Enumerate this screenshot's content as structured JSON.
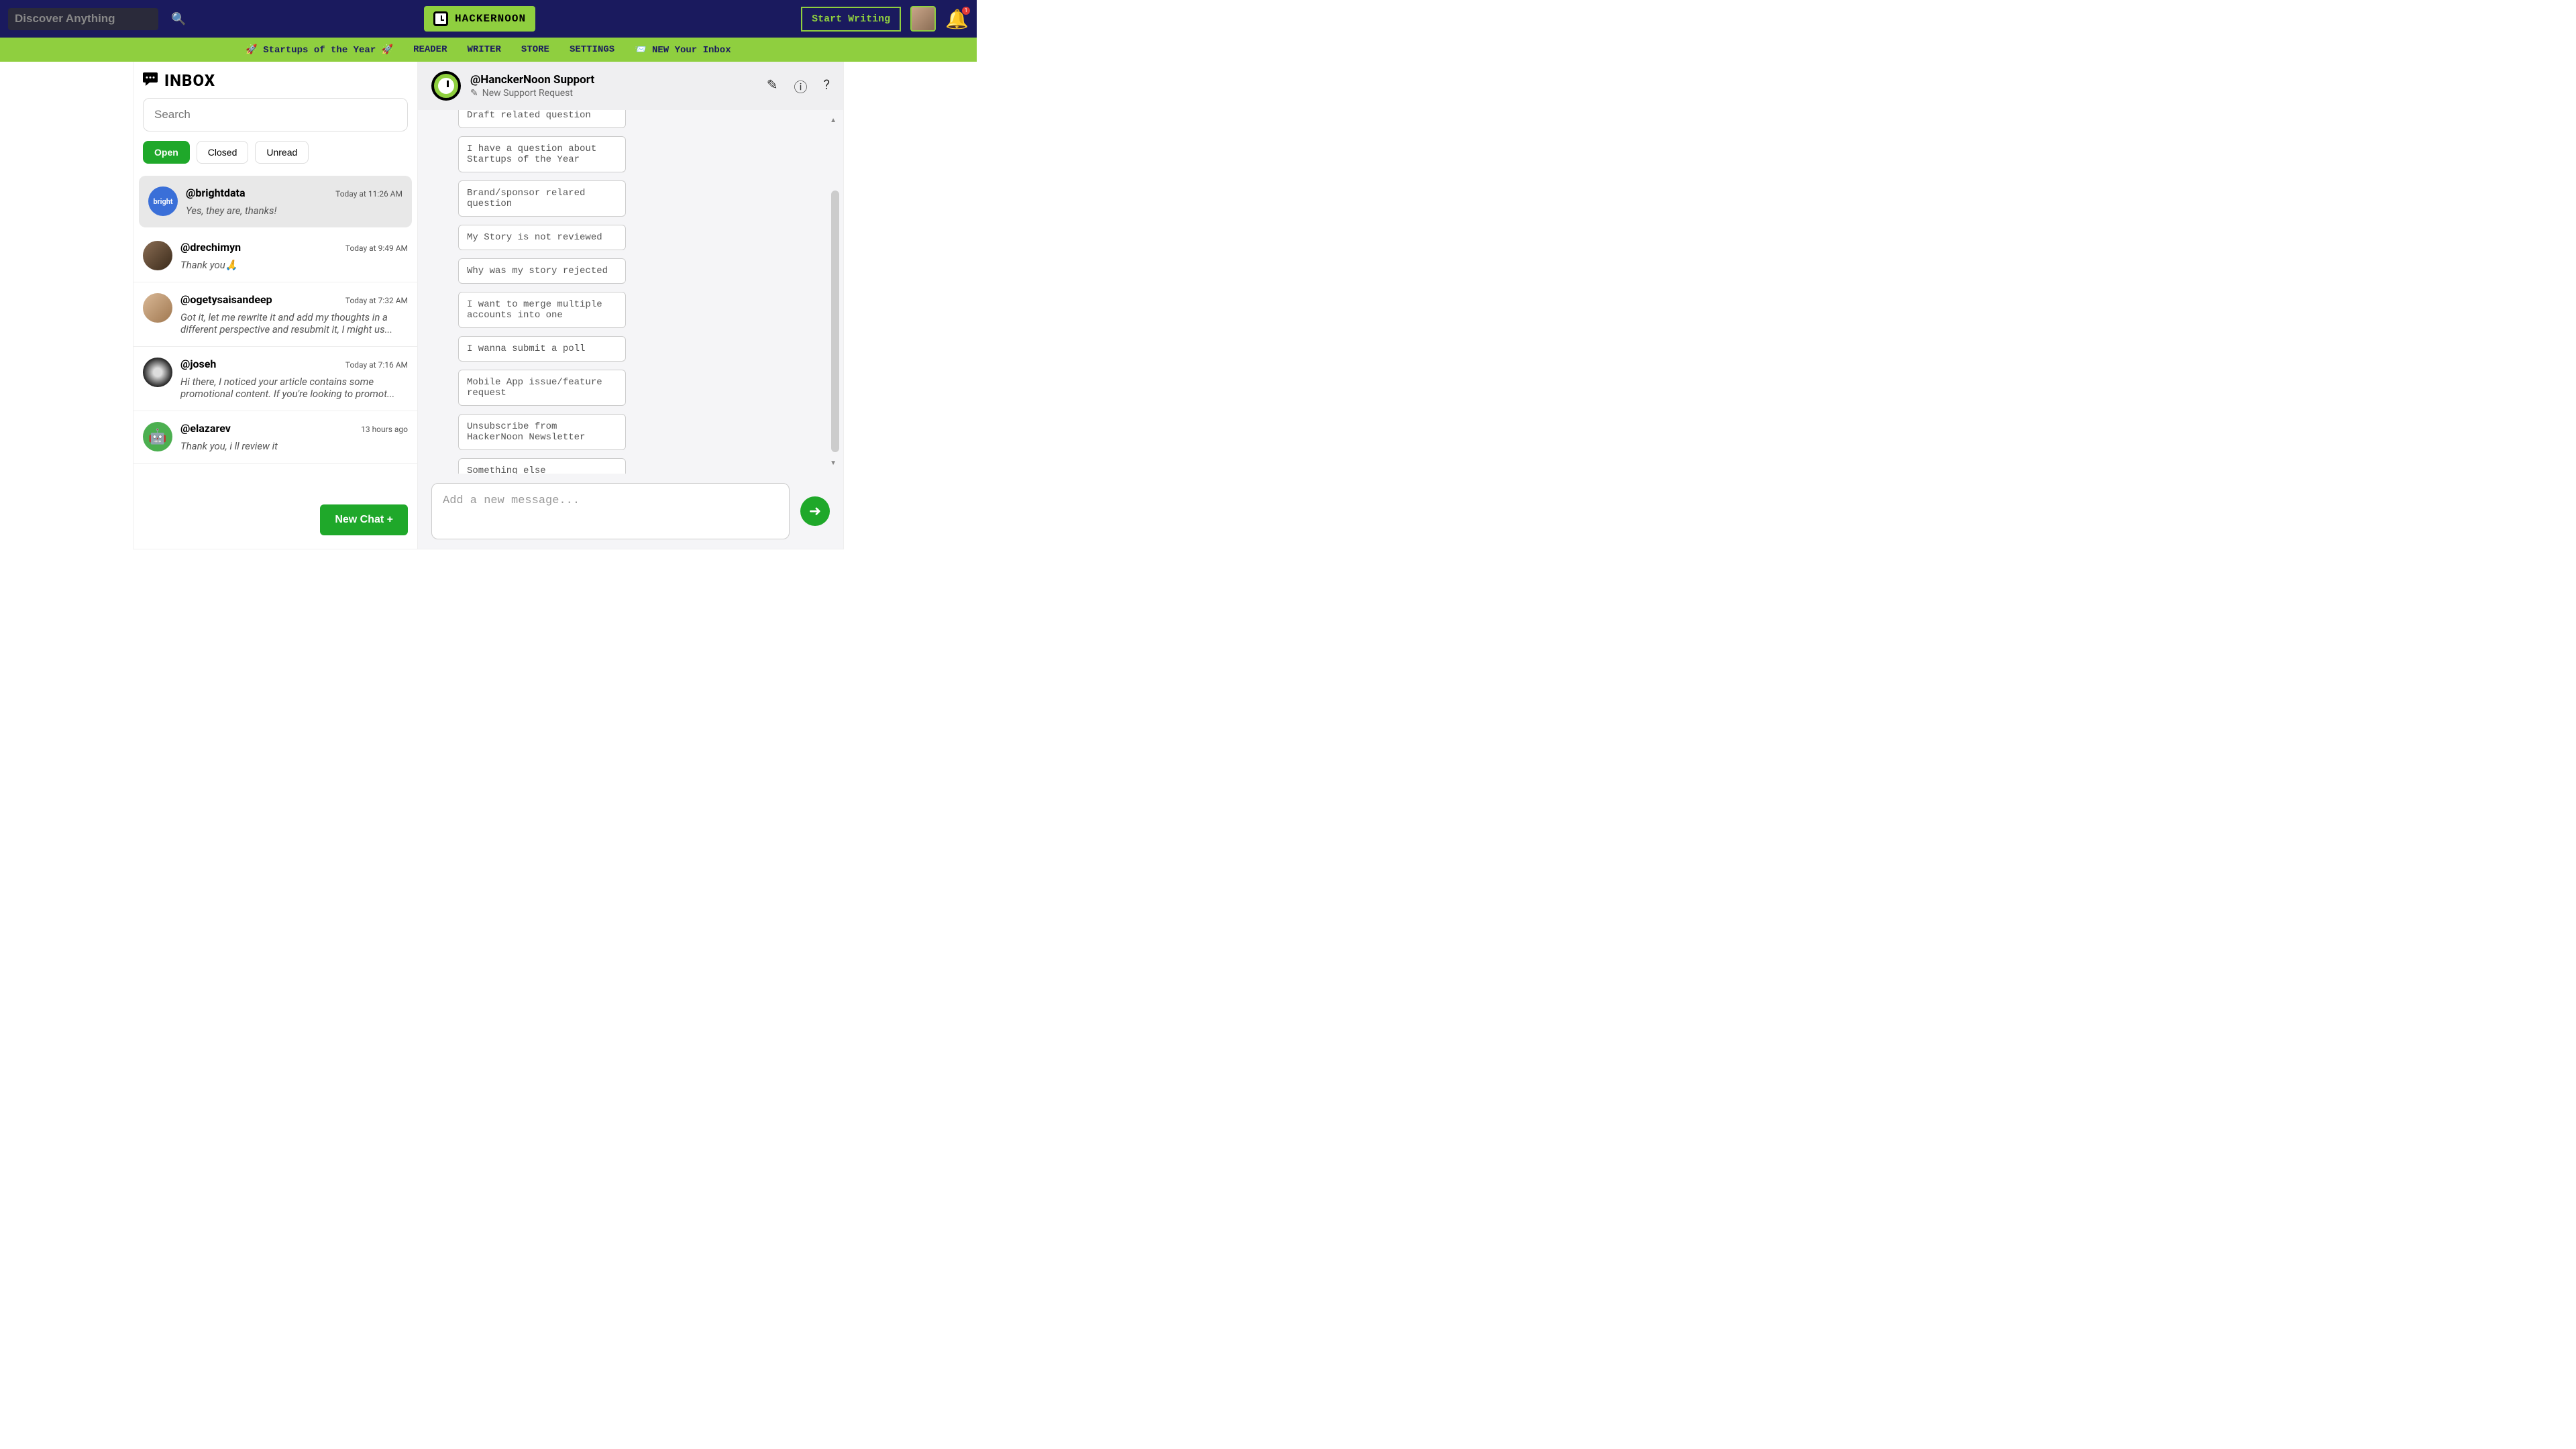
{
  "top": {
    "search_placeholder": "Discover Anything",
    "brand": "HACKERNOON",
    "start_writing": "Start Writing",
    "notif_count": "1"
  },
  "subnav": {
    "startups": "🚀 Startups of the Year 🚀",
    "reader": "READER",
    "writer": "WRITER",
    "store": "STORE",
    "settings": "SETTINGS",
    "inbox": "📨 NEW Your Inbox"
  },
  "inbox": {
    "title": "INBOX",
    "search_placeholder": "Search",
    "filters": {
      "open": "Open",
      "closed": "Closed",
      "unread": "Unread"
    },
    "new_chat": "New Chat +",
    "threads": [
      {
        "handle": "@brightdata",
        "time": "Today at 11:26 AM",
        "preview": "Yes, they are, thanks!",
        "color": "#3a6fd8",
        "initial": "bright"
      },
      {
        "handle": "@drechimyn",
        "time": "Today at 9:49 AM",
        "preview": "Thank you🙏",
        "color": "#6b5843",
        "initial": ""
      },
      {
        "handle": "@ogetysaisandeep",
        "time": "Today at 7:32 AM",
        "preview": "Got it, let me rewrite it and add my thoughts in a different perspective and resubmit it, I might us...",
        "color": "#c9a589",
        "initial": ""
      },
      {
        "handle": "@joseh",
        "time": "Today at 7:16 AM",
        "preview": "Hi there, I noticed your article contains some promotional content. If you're looking to promot...",
        "color": "#444",
        "initial": ""
      },
      {
        "handle": "@elazarev",
        "time": "13 hours ago",
        "preview": "Thank you, i ll review it",
        "color": "#4caf50",
        "initial": ""
      }
    ]
  },
  "chat": {
    "name": "@HanckerNoon Support",
    "subtitle": "New Support Request",
    "options": [
      "Draft related question",
      "I have a question about Startups of the Year",
      "Brand/sponsor relared question",
      "My Story is not reviewed",
      "Why was my story rejected",
      "I want to merge multiple accounts into one",
      "I wanna submit a poll",
      "Mobile App issue/feature request",
      "Unsubscribe from HackerNoon Newsletter",
      "Something else"
    ],
    "compose_placeholder": "Add a new message..."
  }
}
